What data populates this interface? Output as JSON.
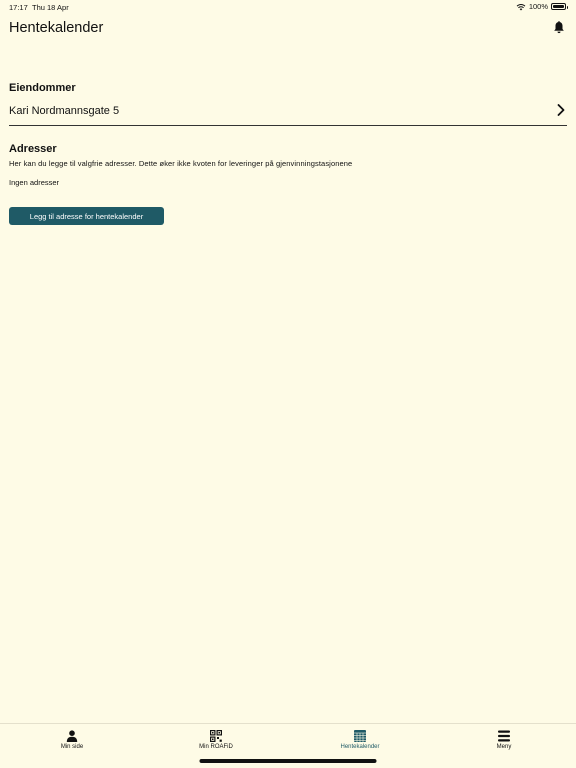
{
  "status_bar": {
    "time": "17:17",
    "date": "Thu 18 Apr",
    "battery": "100%"
  },
  "header": {
    "title": "Hentekalender",
    "notification_icon": "bell-icon"
  },
  "properties": {
    "heading": "Eiendommer",
    "items": [
      {
        "label": "Kari Nordmannsgate 5"
      }
    ]
  },
  "addresses": {
    "heading": "Adresser",
    "description": "Her kan du legge til valgfrie adresser. Dette øker ikke kvoten for leveringer på gjenvinningstasjonene",
    "empty_text": "Ingen adresser",
    "add_button_label": "Legg til adresse for hentekalender"
  },
  "tabs": [
    {
      "label": "Min side",
      "icon": "person-icon",
      "active": false
    },
    {
      "label": "Min ROAFiD",
      "icon": "qr-code-icon",
      "active": false
    },
    {
      "label": "Hentekalender",
      "icon": "calendar-grid-icon",
      "active": true
    },
    {
      "label": "Meny",
      "icon": "menu-icon",
      "active": false
    }
  ],
  "colors": {
    "background": "#fefbe6",
    "accent": "#1f5a66",
    "text": "#111111"
  }
}
